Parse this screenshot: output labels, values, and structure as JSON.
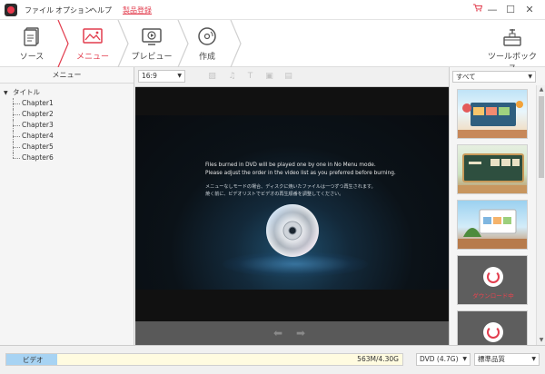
{
  "menu": {
    "file": "ファイル",
    "option": "オプション",
    "help": "ヘルプ",
    "register": "製品登録"
  },
  "window": {
    "minimize": "—",
    "restore": "☐",
    "close": "✕",
    "cart_icon": "cart-icon"
  },
  "steps": [
    {
      "label": "ソース"
    },
    {
      "label": "メニュー"
    },
    {
      "label": "プレビュー"
    },
    {
      "label": "作成"
    }
  ],
  "toolbox": {
    "label": "ツールボックス"
  },
  "left_panel": {
    "header": "メニュー",
    "root": "タイトル",
    "chapters": [
      "Chapter1",
      "Chapter2",
      "Chapter3",
      "Chapter4",
      "Chapter5",
      "Chapter6"
    ]
  },
  "center": {
    "ratio": "16:9",
    "message_en_1": "Files burned in DVD will be played one by one in No Menu mode.",
    "message_en_2": "Please adjust the order in the video list as you preferred before burning.",
    "message_jp_1": "メニューなしモードの場合、ディスクに焼いたファイルは一つずつ再生されます。",
    "message_jp_2": "焼く前に、ビデオリストでビデオの再生順番を調整してください。"
  },
  "right_panel": {
    "filter": "すべて",
    "loading_text": "ダウンロード中"
  },
  "status": {
    "type_label": "ビデオ",
    "size": "563M/4.30G",
    "capacity_fraction": 0.128,
    "disc": "DVD (4.7G)",
    "quality": "標準品質"
  },
  "colors": {
    "accent": "#e23c4d",
    "progress": "#a7d3f3"
  }
}
